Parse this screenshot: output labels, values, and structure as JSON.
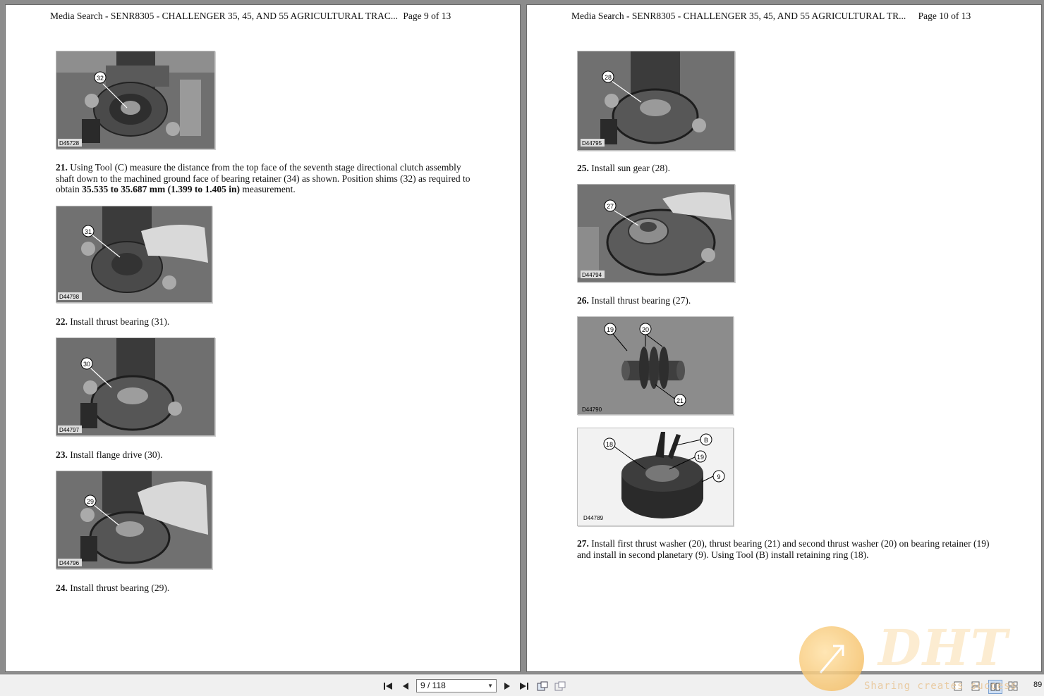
{
  "viewer": {
    "left_page": {
      "header_title": "Media Search - SENR8305 - CHALLENGER 35, 45, AND 55 AGRICULTURAL TRAC...",
      "header_page": "Page 9 of 13",
      "figures": [
        {
          "callout": "32",
          "code": "D45728"
        },
        {
          "callout": "31",
          "code": "D44798"
        },
        {
          "callout": "30",
          "code": "D44797"
        },
        {
          "callout": "29",
          "code": "D44796"
        }
      ],
      "steps": [
        {
          "num": "21.",
          "text_a": " Using Tool (C) measure the distance from the top face of the seventh stage directional clutch assembly shaft down to the machined ground face of bearing retainer (34) as shown. Position shims (32) as required to obtain ",
          "bold": "35.535 to 35.687 mm (1.399 to 1.405 in)",
          "text_b": " measurement."
        },
        {
          "num": "22.",
          "text": " Install thrust bearing (31)."
        },
        {
          "num": "23.",
          "text": " Install flange drive (30)."
        },
        {
          "num": "24.",
          "text": " Install thrust bearing (29)."
        }
      ]
    },
    "right_page": {
      "header_title": "Media Search - SENR8305 - CHALLENGER 35, 45, AND 55 AGRICULTURAL TR...",
      "header_page": "Page 10 of 13",
      "figures": [
        {
          "callout": "28",
          "code": "D44795"
        },
        {
          "callout": "27",
          "code": "D44794"
        },
        {
          "callouts": [
            "19",
            "20",
            "21"
          ],
          "code": "D44790"
        },
        {
          "callouts": [
            "18",
            "B",
            "19",
            "9"
          ],
          "code": "D44789"
        }
      ],
      "steps": [
        {
          "num": "25.",
          "text": " Install sun gear (28)."
        },
        {
          "num": "26.",
          "text": " Install thrust bearing (27)."
        },
        {
          "num": "27.",
          "text": " Install first thrust washer (20), thrust bearing (21) and second thrust washer (20) on bearing retainer (19) and install in second planetary (9). Using Tool (B) install retaining ring (18)."
        }
      ]
    }
  },
  "toolbar": {
    "page_indicator": "9 / 118",
    "zoom_partial": "89",
    "icons": [
      "first-page-icon",
      "prev-page-icon",
      "next-page-icon",
      "last-page-icon",
      "fit-page-icon",
      "fit-width-icon",
      "single-page-icon",
      "continuous-icon",
      "facing-icon",
      "facing-continuous-icon"
    ]
  },
  "watermark": {
    "logo": "DHT",
    "tagline": "Sharing creates success"
  }
}
